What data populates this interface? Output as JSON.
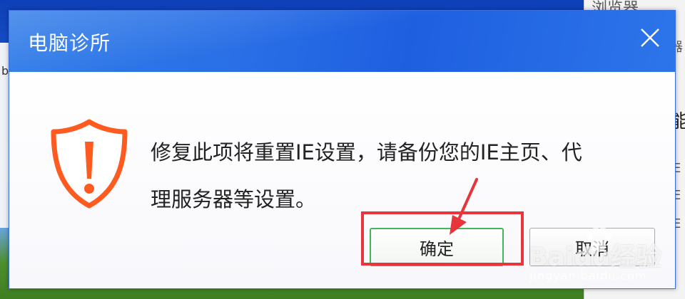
{
  "dialog": {
    "title": "电脑诊所",
    "message_line1": "修复此项将重置IE设置，请备份您的IE主页、代",
    "message_line2": "理服务器等设置。",
    "ok_label": "确定",
    "cancel_label": "取消",
    "icon": "warning-shield-icon",
    "close_icon": "close-icon"
  },
  "background_window": {
    "fragments": [
      "浏览器",
      "器",
      "能",
      "E",
      "E",
      "E"
    ]
  },
  "background_left": {
    "fragment": "b"
  },
  "watermark": {
    "logo": "Baidu经验",
    "url": "jingyan.baidu.com"
  },
  "colors": {
    "titlebar": "#2a6fe6",
    "ok_border": "#41b75a",
    "shield": "#ff5a1f",
    "annotation": "#e8343b"
  }
}
